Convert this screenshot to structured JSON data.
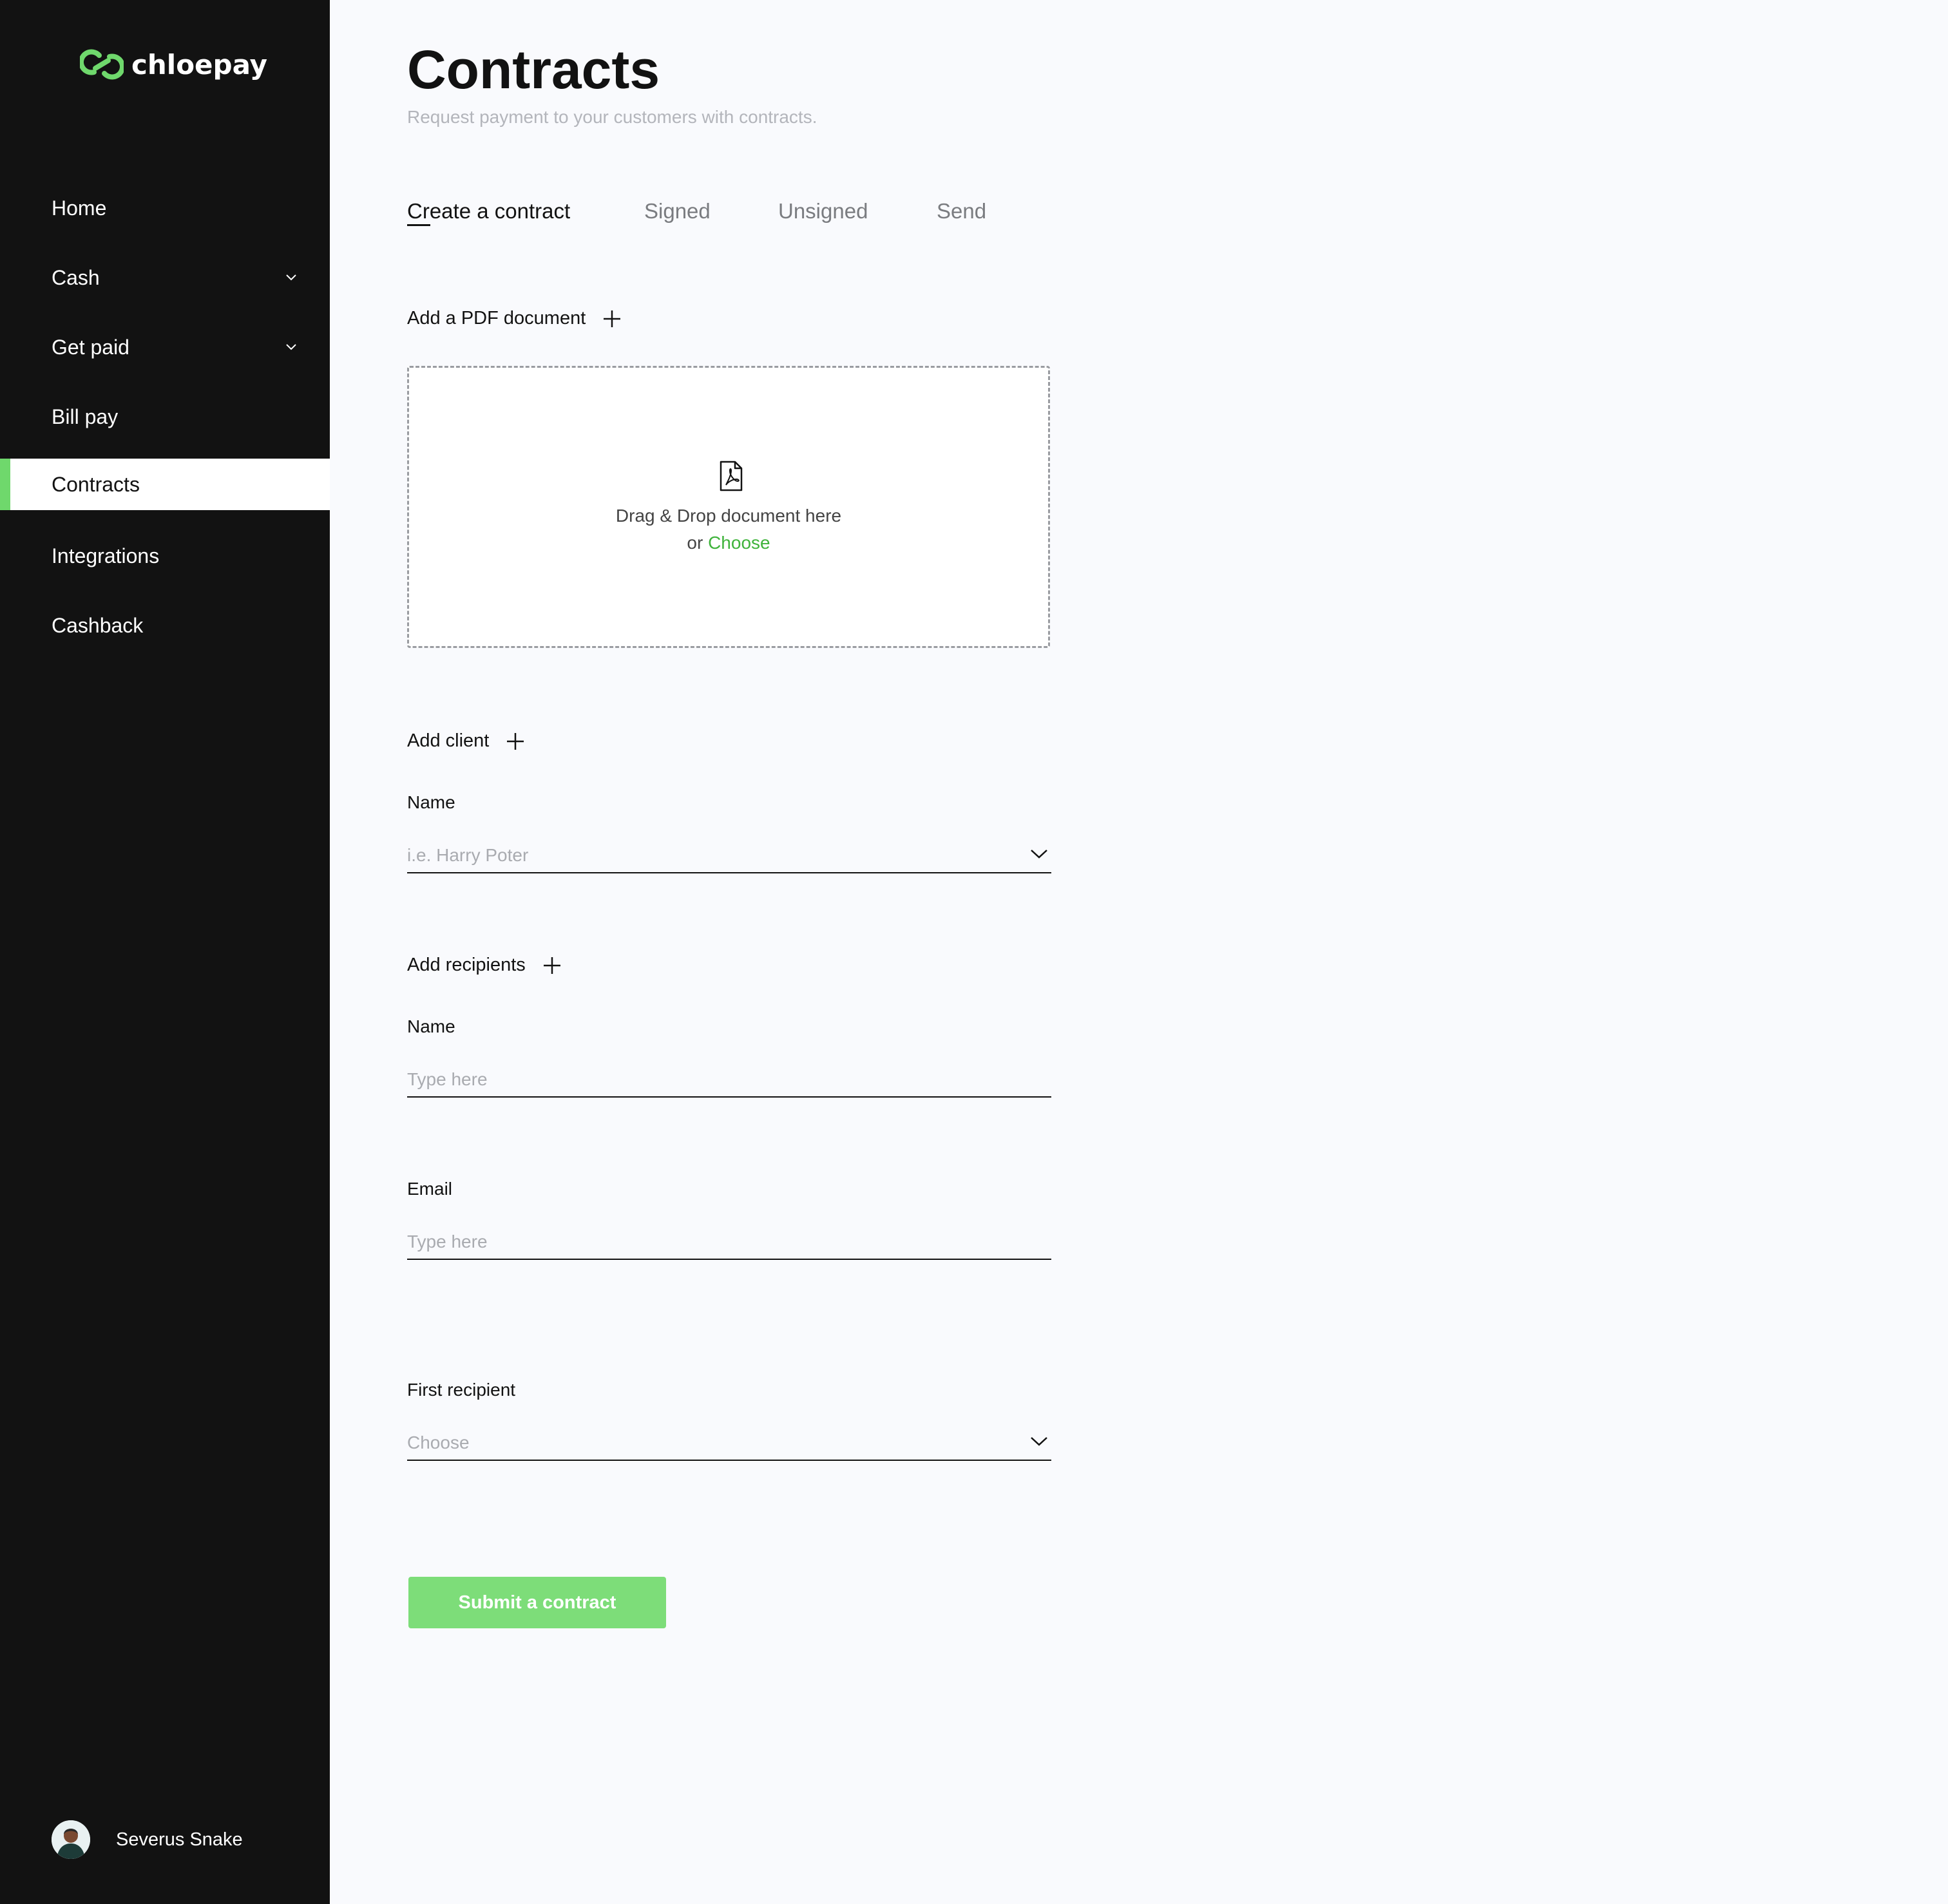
{
  "app": {
    "logo_text": "chloepay",
    "brand_color": "#6fd86c"
  },
  "sidebar": {
    "items": [
      {
        "label": "Home",
        "icon": ""
      },
      {
        "label": "Cash",
        "icon": "chevron-down-icon"
      },
      {
        "label": "Get paid",
        "icon": "chevron-down-icon"
      },
      {
        "label": "Bill pay",
        "icon": ""
      },
      {
        "label": "Contracts",
        "icon": "",
        "active": true
      },
      {
        "label": "Integrations",
        "icon": ""
      },
      {
        "label": "Cashback",
        "icon": ""
      }
    ],
    "user": {
      "name": "Severus Snake"
    }
  },
  "page": {
    "title": "Contracts",
    "subtitle": "Request payment to your customers with contracts."
  },
  "tabs": [
    {
      "label": "Create a contract",
      "active": true
    },
    {
      "label": "Signed"
    },
    {
      "label": "Unsigned"
    },
    {
      "label": "Send"
    }
  ],
  "document": {
    "heading": "Add a PDF document",
    "dropzone_text": "Drag & Drop document here",
    "dropzone_or": "or",
    "dropzone_choose": "Choose"
  },
  "client": {
    "heading": "Add client",
    "name_label": "Name",
    "name_placeholder": "i.e. Harry Poter"
  },
  "recipients": {
    "heading": "Add recipients",
    "name_label": "Name",
    "name_placeholder": "Type here",
    "email_label": "Email",
    "email_placeholder": "Type here",
    "first_label": "First recipient",
    "first_placeholder": "Choose"
  },
  "submit_label": "Submit a contract"
}
